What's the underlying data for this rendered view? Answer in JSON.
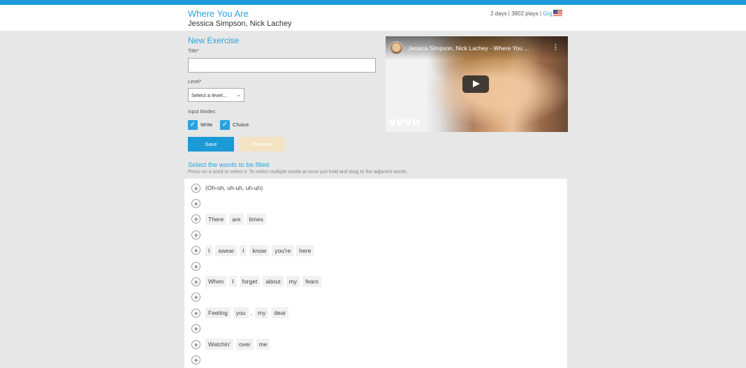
{
  "header": {
    "song_title": "Where You Are",
    "artist": "Jessica Simpson, Nick Lachey",
    "stats_text": "2 days | 3902 plays | ",
    "stats_link": "Grg"
  },
  "form": {
    "heading": "New Exercise",
    "title_label": "Title*",
    "title_value": "",
    "level_label": "Level*",
    "level_selected": "Select a level...",
    "input_modes_label": "Input Modes:",
    "write_label": "Write",
    "choice_label": "Choice",
    "write_checked": true,
    "choice_checked": true,
    "save_label": "Save",
    "preview_label": "Preview"
  },
  "video": {
    "title": "Jessica Simpson, Nick Lachey - Where You ...",
    "menu": "⋮",
    "brand": "vevo"
  },
  "lyrics": {
    "heading": "Select the words to be filled",
    "instructions": "Press on a word to select it. To select multiple words at once just hold and drag to the adjacent words.",
    "lines": [
      {
        "words": [
          "(Oh-oh, uh-uh, uh-uh)"
        ]
      },
      {
        "words": []
      },
      {
        "words": [
          "There",
          "are",
          "times"
        ]
      },
      {
        "words": []
      },
      {
        "words": [
          "I",
          "swear",
          "I",
          "know",
          "you're",
          "here"
        ]
      },
      {
        "words": []
      },
      {
        "words": [
          "When",
          "I",
          "forget",
          "about",
          "my",
          "fears"
        ]
      },
      {
        "words": []
      },
      {
        "words": [
          "Feeling",
          "you",
          ",",
          "my",
          "dear"
        ]
      },
      {
        "words": []
      },
      {
        "words": [
          "Watchin'",
          "over",
          "me"
        ]
      },
      {
        "words": []
      }
    ]
  },
  "colors": {
    "accent": "#1c9ad6",
    "panel": "#e7e7e7",
    "preview_disabled": "#f3e3c2"
  }
}
